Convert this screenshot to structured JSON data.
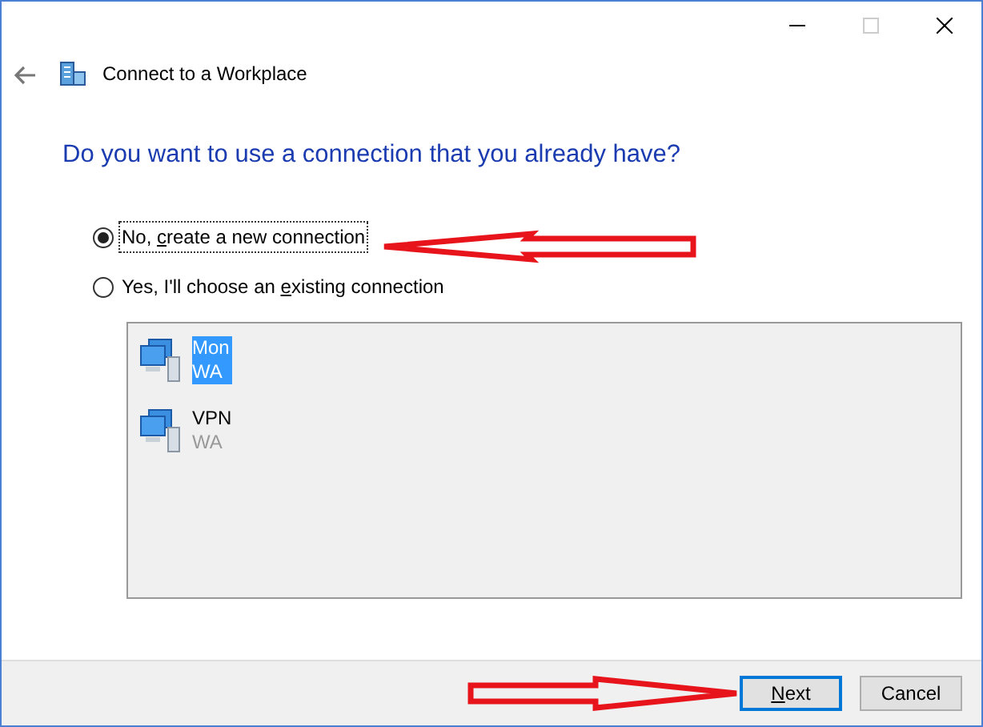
{
  "window": {
    "title": "Connect to a Workplace"
  },
  "heading": "Do you want to use a connection that you already have?",
  "options": [
    {
      "before": "No, ",
      "key": "c",
      "after": "reate a new connection",
      "selected": true
    },
    {
      "before": "Yes, I'll choose an ",
      "key": "e",
      "after": "xisting connection",
      "selected": false
    }
  ],
  "connections": [
    {
      "name": "Mon",
      "type": "WA",
      "selected": true
    },
    {
      "name": "VPN",
      "type": "WA",
      "selected": false
    }
  ],
  "buttons": [
    {
      "key": "N",
      "after": "ext",
      "default": true
    },
    {
      "after": "Cancel",
      "default": false
    }
  ]
}
